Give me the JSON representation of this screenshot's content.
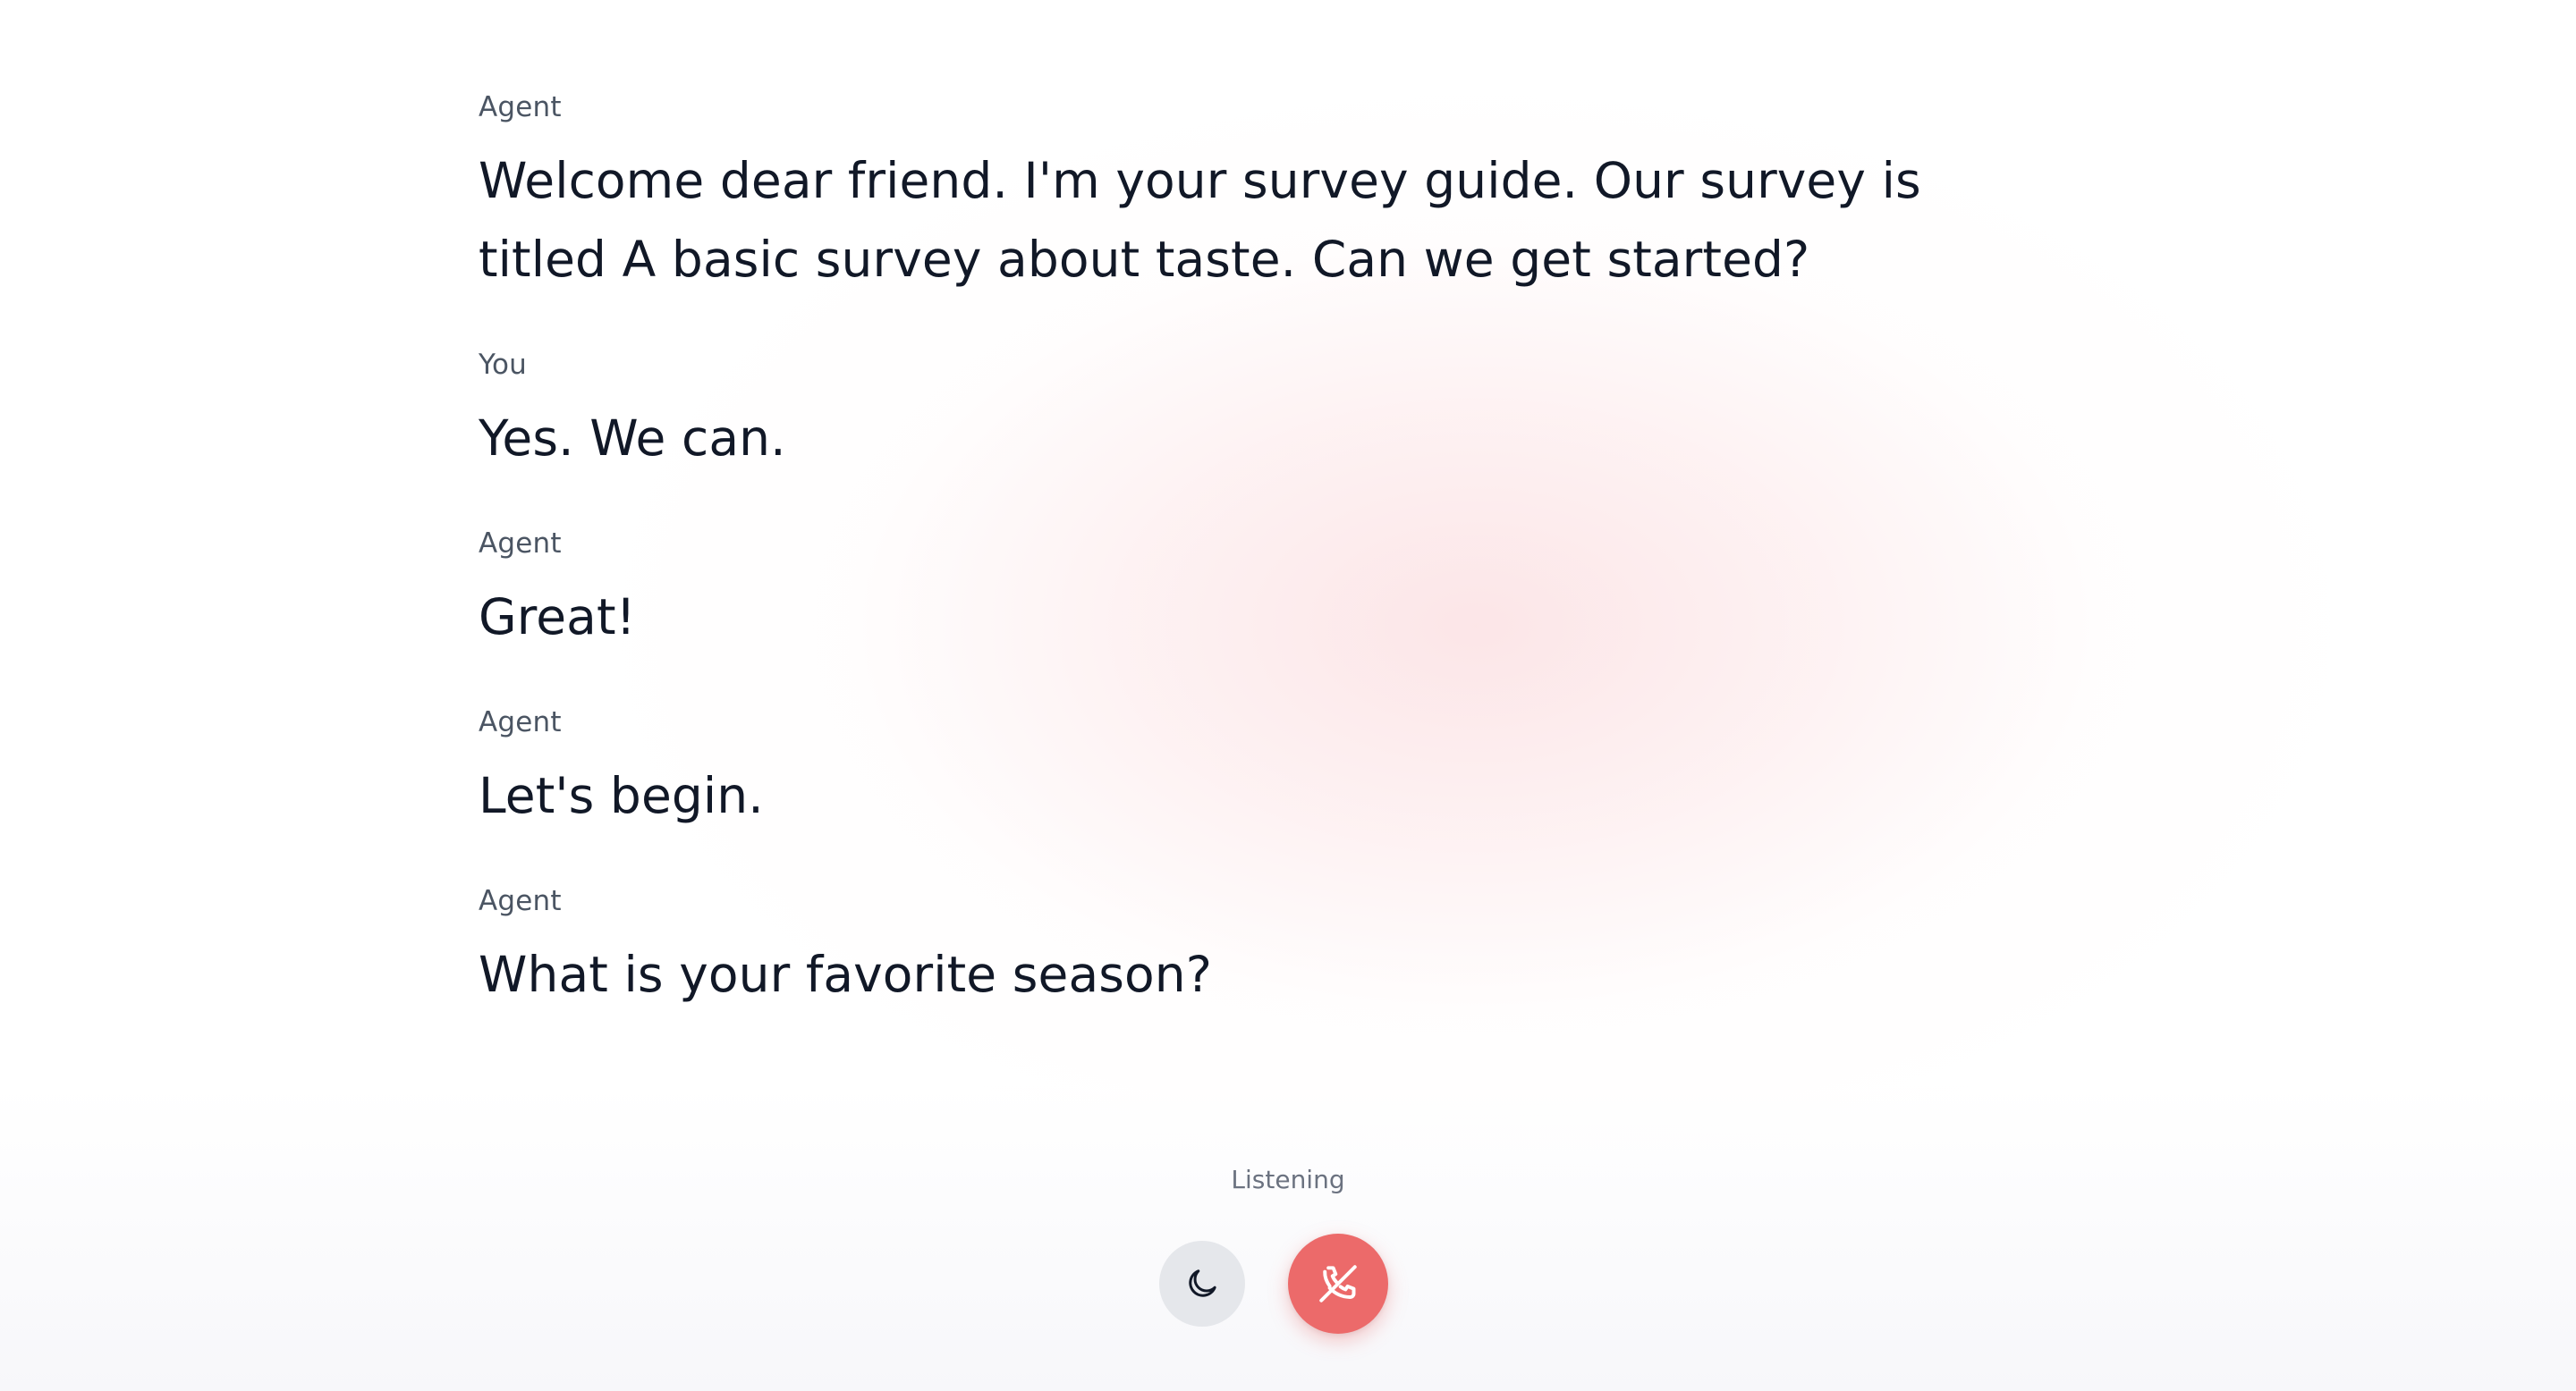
{
  "transcript": {
    "messages": [
      {
        "speaker": "Agent",
        "text": "Welcome dear friend. I'm your survey guide. Our survey is titled A basic survey about taste. Can we get started?"
      },
      {
        "speaker": "You",
        "text": "Yes. We can."
      },
      {
        "speaker": "Agent",
        "text": "Great!"
      },
      {
        "speaker": "Agent",
        "text": "Let's begin."
      },
      {
        "speaker": "Agent",
        "text": "What is your favorite season?"
      }
    ]
  },
  "status": {
    "label": "Listening"
  },
  "controls": {
    "theme_icon": "moon-icon",
    "hangup_icon": "phone-off-icon",
    "hangup_color": "#ec6a6a"
  },
  "colors": {
    "background_glow": "#fce4e6",
    "text_primary": "#111827",
    "text_secondary": "#4b5563"
  }
}
